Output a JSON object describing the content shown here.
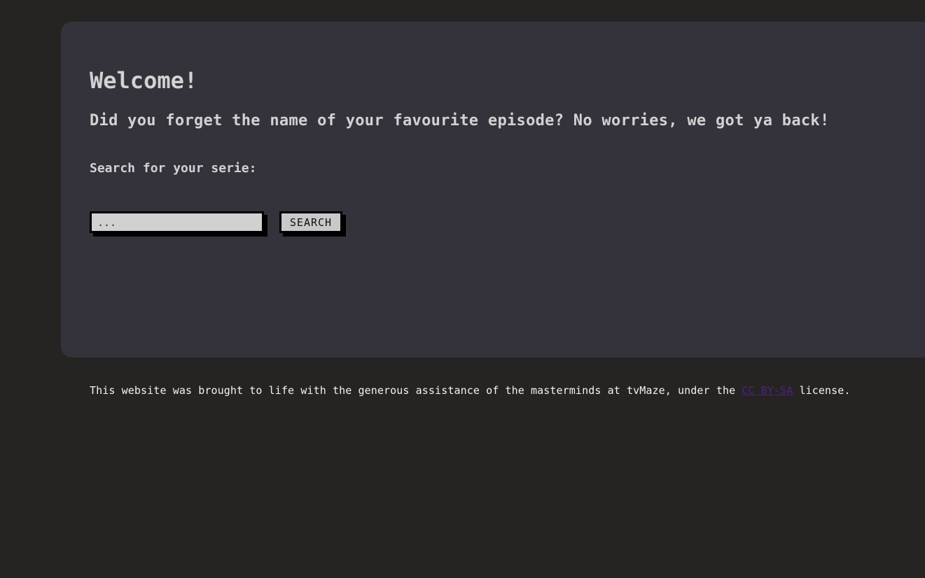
{
  "main": {
    "heading": "Welcome!",
    "tagline": "Did you forget the name of your favourite episode? No worries, we got ya back!",
    "search_label": "Search for your serie:",
    "search": {
      "placeholder": "...",
      "value": "",
      "button_label": "SEARCH"
    }
  },
  "footer": {
    "text_before": "This website was brought to life with the generous assistance of the masterminds at tvMaze, under the ",
    "license_link": "CC BY-SA",
    "text_after": " license."
  },
  "colors": {
    "page_background": "#252422",
    "card_background": "#34333c",
    "input_background": "#d1d1d1",
    "link": "#4b2382"
  }
}
